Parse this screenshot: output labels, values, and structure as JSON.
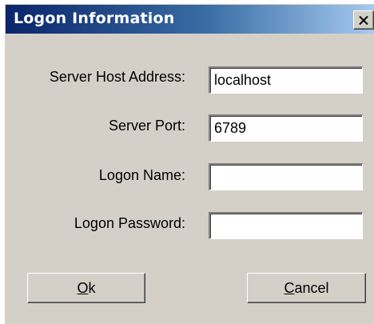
{
  "window": {
    "title": "Logon Information",
    "close_icon": "close-icon"
  },
  "form": {
    "server_host": {
      "label": "Server Host Address:",
      "value": "localhost"
    },
    "server_port": {
      "label": "Server Port:",
      "value": "6789"
    },
    "logon_name": {
      "label": "Logon Name:",
      "value": ""
    },
    "logon_password": {
      "label": "Logon Password:",
      "value": ""
    }
  },
  "buttons": {
    "ok": {
      "accel": "O",
      "rest": "k"
    },
    "cancel": {
      "accel": "C",
      "rest": "ancel"
    }
  },
  "colors": {
    "dialog_face": "#d4d0c8",
    "title_start": "#0a246a",
    "title_end": "#a6caf0",
    "title_text": "#ffffff"
  }
}
